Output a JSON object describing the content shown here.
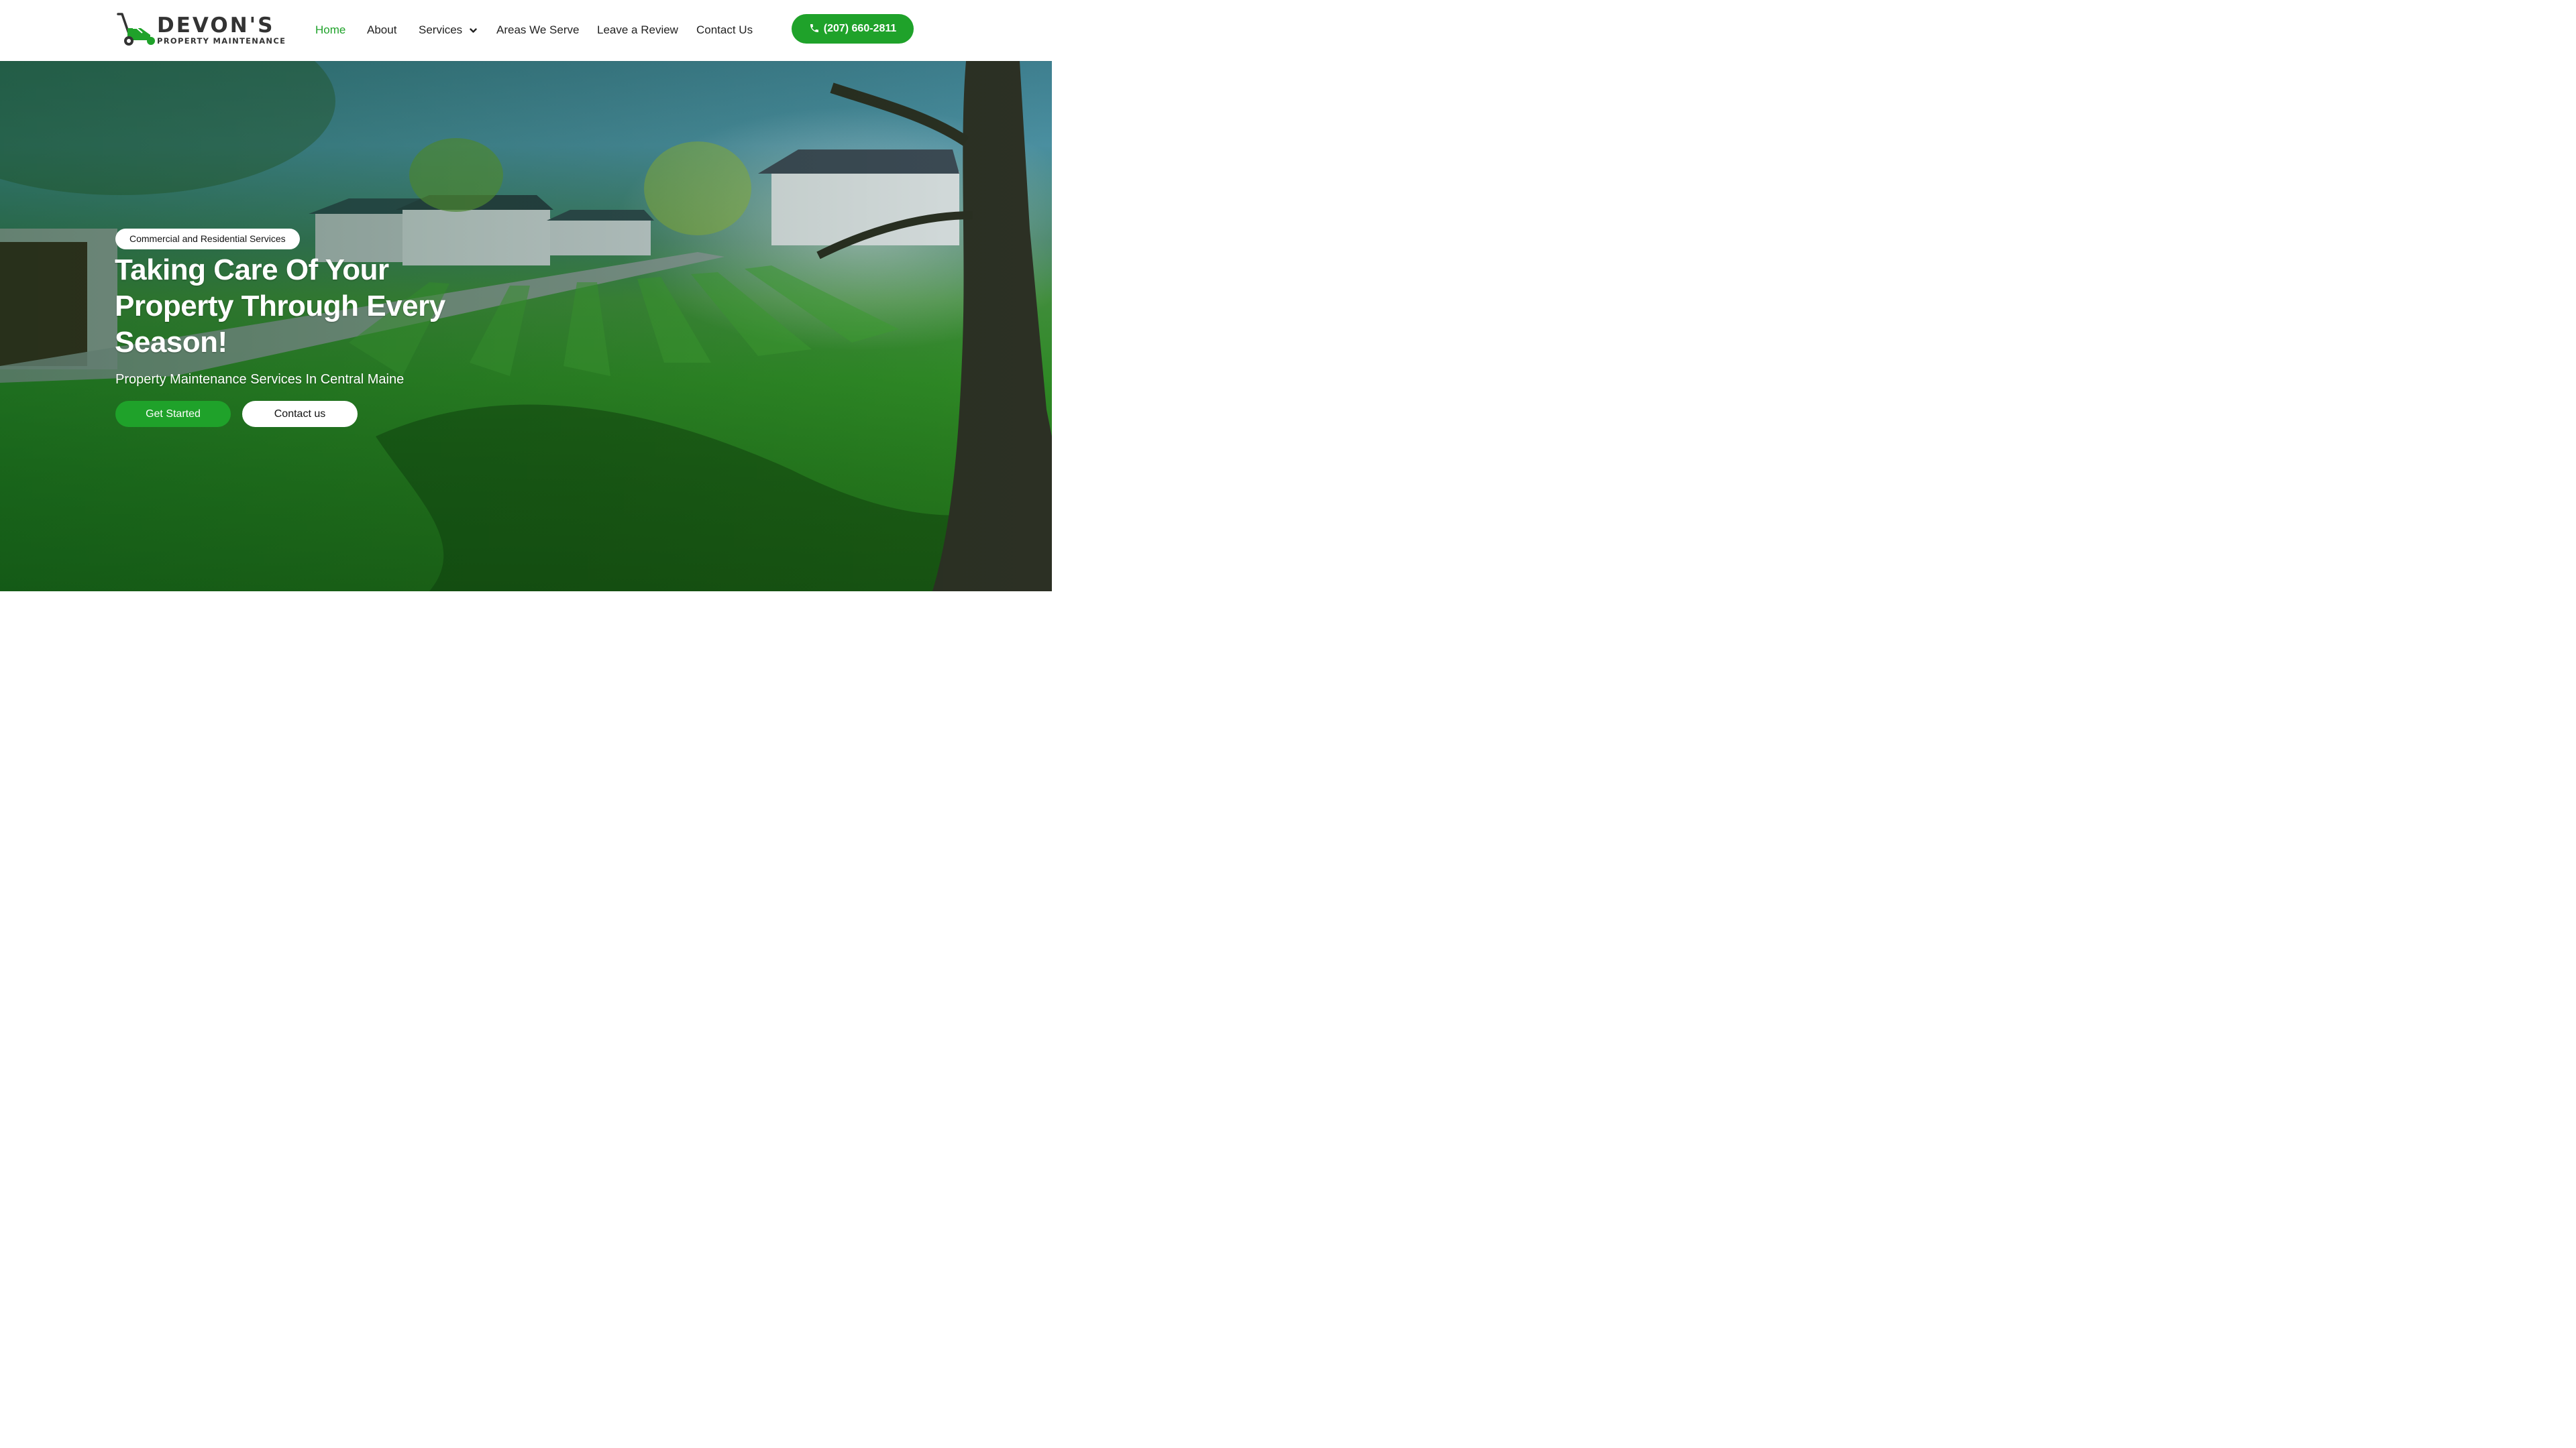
{
  "brand": {
    "name": "DEVON'S",
    "tagline": "PROPERTY MAINTENANCE",
    "logo_icon": "lawn-mower-icon",
    "colors": {
      "accent": "#1fa22a",
      "text": "#222222"
    }
  },
  "nav": {
    "items": [
      {
        "label": "Home",
        "active": true
      },
      {
        "label": "About"
      },
      {
        "label": "Services",
        "has_dropdown": true,
        "icon": "chevron-down-icon"
      },
      {
        "label": "Areas We Serve"
      },
      {
        "label": "Leave a Review"
      },
      {
        "label": "Contact Us"
      }
    ],
    "phone": {
      "label": "(207) 660-2811",
      "icon": "phone-icon"
    }
  },
  "hero": {
    "tag": "Commercial and Residential Services",
    "headline": "Taking Care Of Your Property Through Every Season!",
    "subheadline": "Property Maintenance Services In Central Maine",
    "primary_cta": "Get Started",
    "secondary_cta": "Contact us"
  }
}
